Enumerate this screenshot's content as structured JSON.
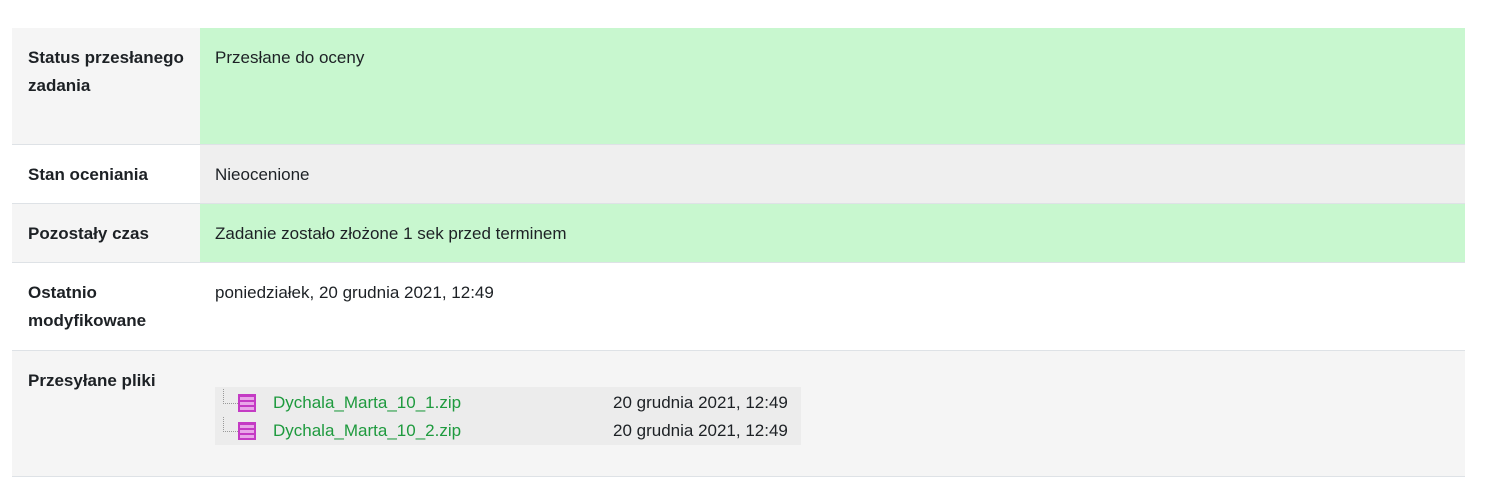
{
  "rows": [
    {
      "label": "Status przesłanego zadania",
      "value": "Przesłane do oceny"
    },
    {
      "label": "Stan oceniania",
      "value": "Nieocenione"
    },
    {
      "label": "Pozostały czas",
      "value": "Zadanie zostało złożone 1 sek przed terminem"
    },
    {
      "label": "Ostatnio modyfikowane",
      "value": "poniedziałek, 20 grudnia 2021, 12:49"
    },
    {
      "label": "Przesyłane pliki"
    }
  ],
  "files": [
    {
      "name": "Dychala_Marta_10_1.zip",
      "date": "20 grudnia 2021, 12:49",
      "icon": "zip-archive-icon"
    },
    {
      "name": "Dychala_Marta_10_2.zip",
      "date": "20 grudnia 2021, 12:49",
      "icon": "zip-archive-icon"
    }
  ],
  "colors": {
    "submitted_bg": "#c8f7cf",
    "neutral_bg": "#efefef",
    "link": "#1e9a3e",
    "icon": "#c43bc4"
  }
}
